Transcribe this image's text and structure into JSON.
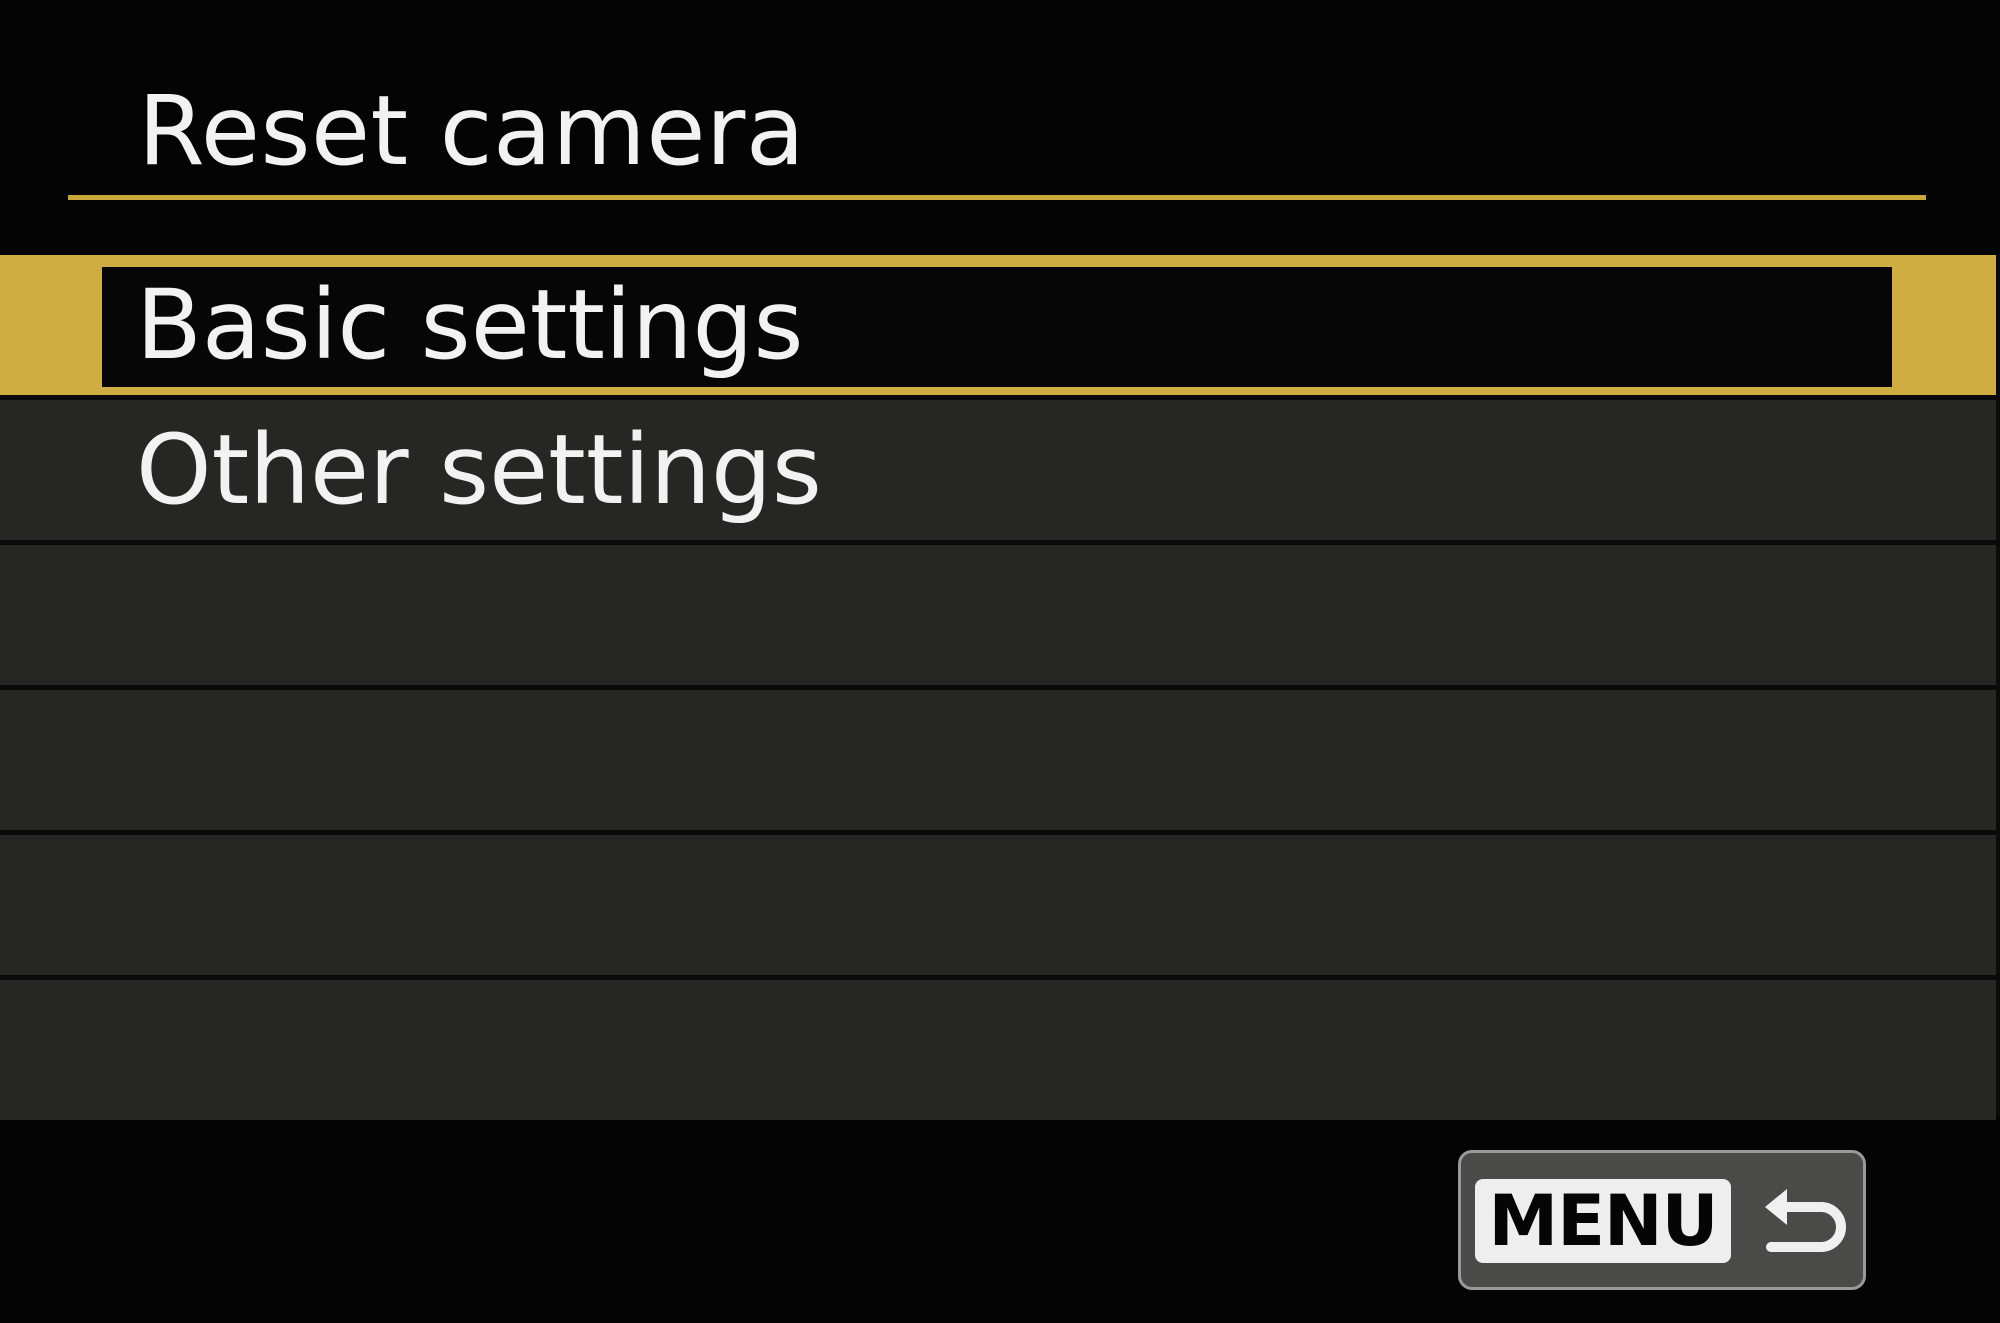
{
  "screen": {
    "title": "Reset camera"
  },
  "menu": {
    "items": [
      {
        "label": "Basic settings",
        "selected": true
      },
      {
        "label": "Other settings",
        "selected": false
      },
      {
        "label": "",
        "selected": false
      },
      {
        "label": "",
        "selected": false
      },
      {
        "label": "",
        "selected": false
      },
      {
        "label": "",
        "selected": false
      }
    ]
  },
  "footer": {
    "menu_button_label": "MENU",
    "return_icon": "return-arrow-icon"
  },
  "colors": {
    "accent": "#c9a83a",
    "background": "#040404",
    "row": "#262724"
  }
}
